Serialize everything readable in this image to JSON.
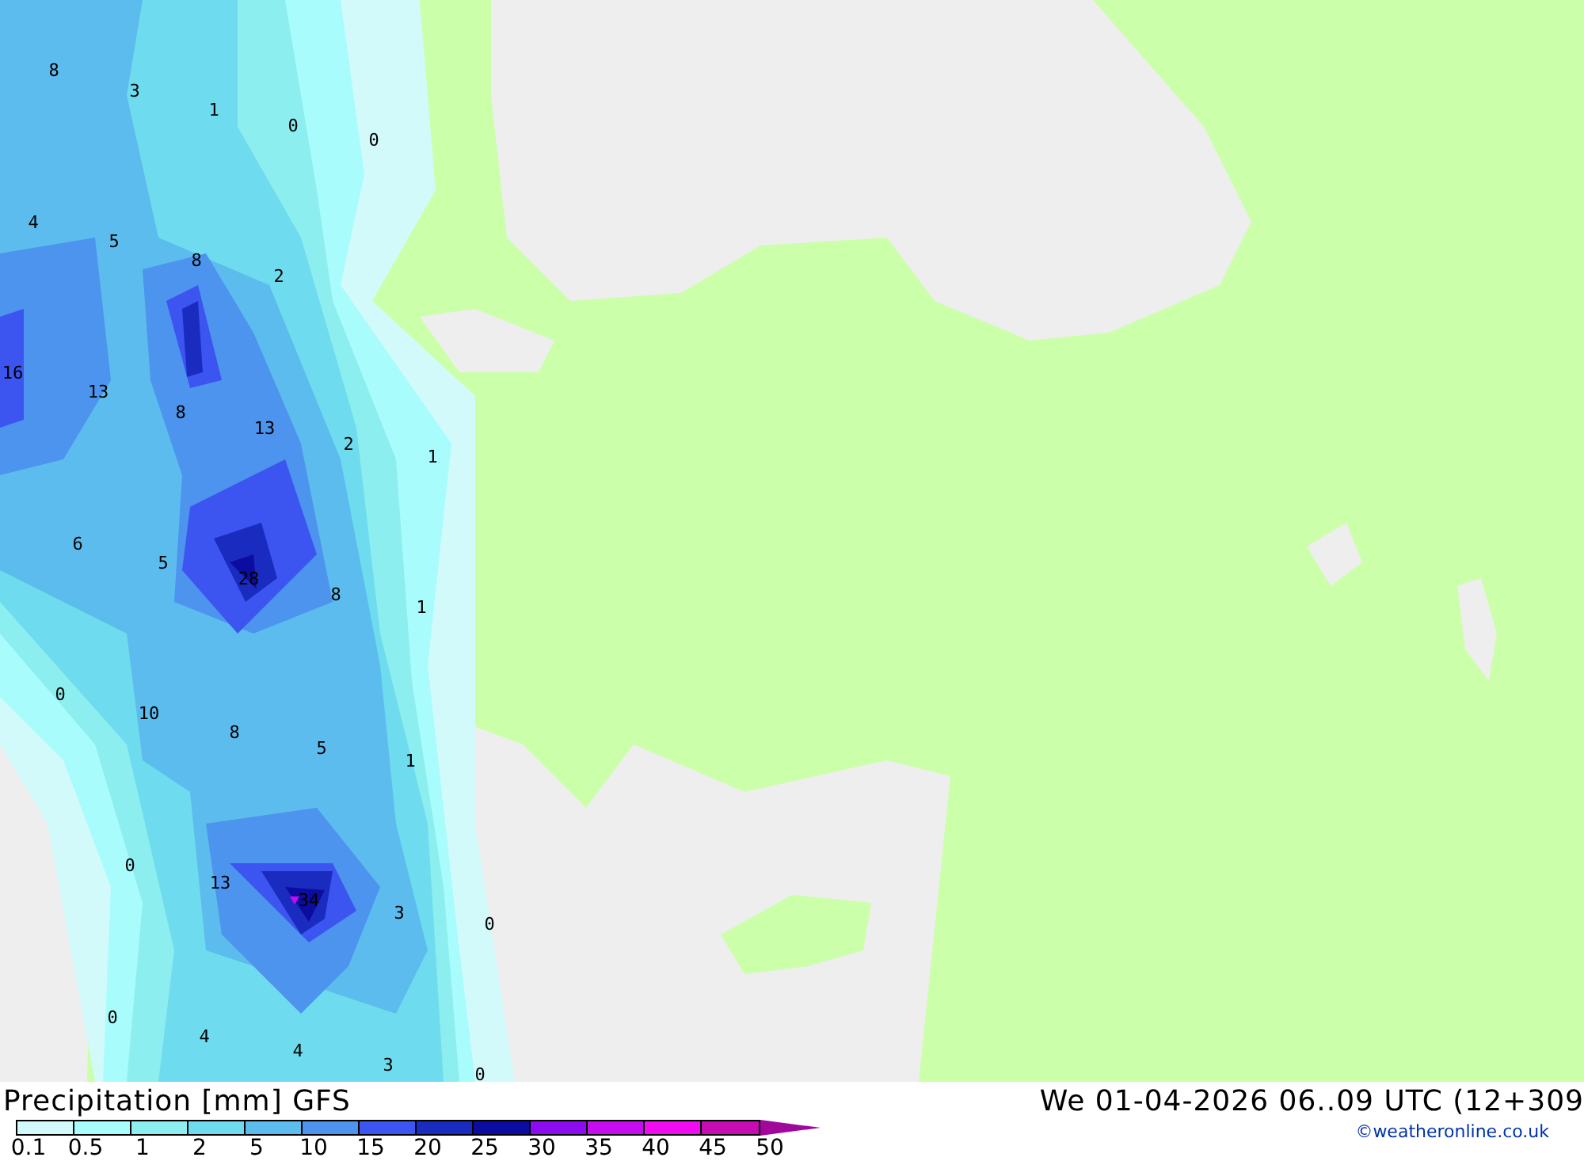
{
  "map": {
    "value_labels": [
      "8",
      "3",
      "1",
      "0",
      "0",
      "4",
      "5",
      "8",
      "2",
      "16",
      "13",
      "8",
      "13",
      "2",
      "1",
      "6",
      "5",
      "28",
      "8",
      "1",
      "0",
      "10",
      "8",
      "5",
      "1",
      "0",
      "13",
      "34",
      "3",
      "0",
      "0",
      "4",
      "4",
      "3",
      "0"
    ]
  },
  "footer": {
    "title": "Precipitation [mm] GFS",
    "valid_time": "We 01-04-2026 06..09 UTC (12+309",
    "credit": "©weatheronline.co.uk"
  },
  "legend": {
    "segments": [
      {
        "kind": "band",
        "color": "#d2fafa"
      },
      {
        "kind": "band",
        "color": "#a8fcfc"
      },
      {
        "kind": "band",
        "color": "#8ceeee"
      },
      {
        "kind": "band",
        "color": "#6edcee"
      },
      {
        "kind": "band",
        "color": "#5cbcee"
      },
      {
        "kind": "band",
        "color": "#4c94ee"
      },
      {
        "kind": "band",
        "color": "#3c54f0"
      },
      {
        "kind": "band",
        "color": "#1a2cc0"
      },
      {
        "kind": "band",
        "color": "#0c0ca0"
      },
      {
        "kind": "band",
        "color": "#8c0cf0"
      },
      {
        "kind": "band",
        "color": "#c80cf0"
      },
      {
        "kind": "band",
        "color": "#f00cf0"
      },
      {
        "kind": "band",
        "color": "#c80cb4"
      },
      {
        "kind": "arrow",
        "color": "#a0089c"
      }
    ],
    "ticks": [
      "0.1",
      "0.5",
      "1",
      "2",
      "5",
      "10",
      "15",
      "20",
      "25",
      "30",
      "35",
      "40",
      "45",
      "50"
    ]
  }
}
